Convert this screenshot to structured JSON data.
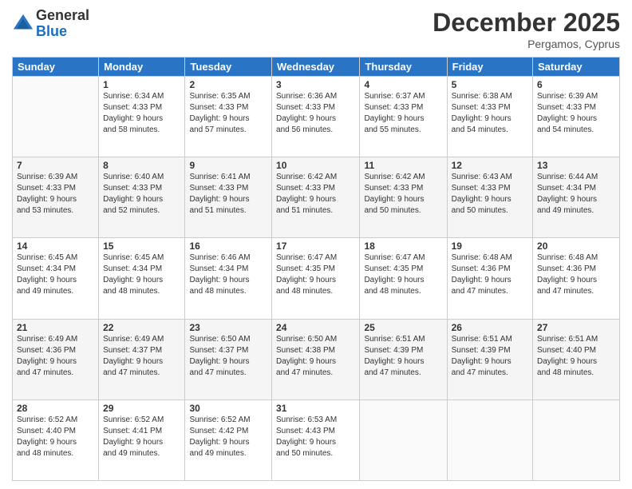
{
  "logo": {
    "general": "General",
    "blue": "Blue"
  },
  "title": "December 2025",
  "location": "Pergamos, Cyprus",
  "days_of_week": [
    "Sunday",
    "Monday",
    "Tuesday",
    "Wednesday",
    "Thursday",
    "Friday",
    "Saturday"
  ],
  "weeks": [
    [
      {
        "day": "",
        "info": ""
      },
      {
        "day": "1",
        "info": "Sunrise: 6:34 AM\nSunset: 4:33 PM\nDaylight: 9 hours\nand 58 minutes."
      },
      {
        "day": "2",
        "info": "Sunrise: 6:35 AM\nSunset: 4:33 PM\nDaylight: 9 hours\nand 57 minutes."
      },
      {
        "day": "3",
        "info": "Sunrise: 6:36 AM\nSunset: 4:33 PM\nDaylight: 9 hours\nand 56 minutes."
      },
      {
        "day": "4",
        "info": "Sunrise: 6:37 AM\nSunset: 4:33 PM\nDaylight: 9 hours\nand 55 minutes."
      },
      {
        "day": "5",
        "info": "Sunrise: 6:38 AM\nSunset: 4:33 PM\nDaylight: 9 hours\nand 54 minutes."
      },
      {
        "day": "6",
        "info": "Sunrise: 6:39 AM\nSunset: 4:33 PM\nDaylight: 9 hours\nand 54 minutes."
      }
    ],
    [
      {
        "day": "7",
        "info": "Sunrise: 6:39 AM\nSunset: 4:33 PM\nDaylight: 9 hours\nand 53 minutes."
      },
      {
        "day": "8",
        "info": "Sunrise: 6:40 AM\nSunset: 4:33 PM\nDaylight: 9 hours\nand 52 minutes."
      },
      {
        "day": "9",
        "info": "Sunrise: 6:41 AM\nSunset: 4:33 PM\nDaylight: 9 hours\nand 51 minutes."
      },
      {
        "day": "10",
        "info": "Sunrise: 6:42 AM\nSunset: 4:33 PM\nDaylight: 9 hours\nand 51 minutes."
      },
      {
        "day": "11",
        "info": "Sunrise: 6:42 AM\nSunset: 4:33 PM\nDaylight: 9 hours\nand 50 minutes."
      },
      {
        "day": "12",
        "info": "Sunrise: 6:43 AM\nSunset: 4:33 PM\nDaylight: 9 hours\nand 50 minutes."
      },
      {
        "day": "13",
        "info": "Sunrise: 6:44 AM\nSunset: 4:34 PM\nDaylight: 9 hours\nand 49 minutes."
      }
    ],
    [
      {
        "day": "14",
        "info": "Sunrise: 6:45 AM\nSunset: 4:34 PM\nDaylight: 9 hours\nand 49 minutes."
      },
      {
        "day": "15",
        "info": "Sunrise: 6:45 AM\nSunset: 4:34 PM\nDaylight: 9 hours\nand 48 minutes."
      },
      {
        "day": "16",
        "info": "Sunrise: 6:46 AM\nSunset: 4:34 PM\nDaylight: 9 hours\nand 48 minutes."
      },
      {
        "day": "17",
        "info": "Sunrise: 6:47 AM\nSunset: 4:35 PM\nDaylight: 9 hours\nand 48 minutes."
      },
      {
        "day": "18",
        "info": "Sunrise: 6:47 AM\nSunset: 4:35 PM\nDaylight: 9 hours\nand 48 minutes."
      },
      {
        "day": "19",
        "info": "Sunrise: 6:48 AM\nSunset: 4:36 PM\nDaylight: 9 hours\nand 47 minutes."
      },
      {
        "day": "20",
        "info": "Sunrise: 6:48 AM\nSunset: 4:36 PM\nDaylight: 9 hours\nand 47 minutes."
      }
    ],
    [
      {
        "day": "21",
        "info": "Sunrise: 6:49 AM\nSunset: 4:36 PM\nDaylight: 9 hours\nand 47 minutes."
      },
      {
        "day": "22",
        "info": "Sunrise: 6:49 AM\nSunset: 4:37 PM\nDaylight: 9 hours\nand 47 minutes."
      },
      {
        "day": "23",
        "info": "Sunrise: 6:50 AM\nSunset: 4:37 PM\nDaylight: 9 hours\nand 47 minutes."
      },
      {
        "day": "24",
        "info": "Sunrise: 6:50 AM\nSunset: 4:38 PM\nDaylight: 9 hours\nand 47 minutes."
      },
      {
        "day": "25",
        "info": "Sunrise: 6:51 AM\nSunset: 4:39 PM\nDaylight: 9 hours\nand 47 minutes."
      },
      {
        "day": "26",
        "info": "Sunrise: 6:51 AM\nSunset: 4:39 PM\nDaylight: 9 hours\nand 47 minutes."
      },
      {
        "day": "27",
        "info": "Sunrise: 6:51 AM\nSunset: 4:40 PM\nDaylight: 9 hours\nand 48 minutes."
      }
    ],
    [
      {
        "day": "28",
        "info": "Sunrise: 6:52 AM\nSunset: 4:40 PM\nDaylight: 9 hours\nand 48 minutes."
      },
      {
        "day": "29",
        "info": "Sunrise: 6:52 AM\nSunset: 4:41 PM\nDaylight: 9 hours\nand 49 minutes."
      },
      {
        "day": "30",
        "info": "Sunrise: 6:52 AM\nSunset: 4:42 PM\nDaylight: 9 hours\nand 49 minutes."
      },
      {
        "day": "31",
        "info": "Sunrise: 6:53 AM\nSunset: 4:43 PM\nDaylight: 9 hours\nand 50 minutes."
      },
      {
        "day": "",
        "info": ""
      },
      {
        "day": "",
        "info": ""
      },
      {
        "day": "",
        "info": ""
      }
    ]
  ]
}
